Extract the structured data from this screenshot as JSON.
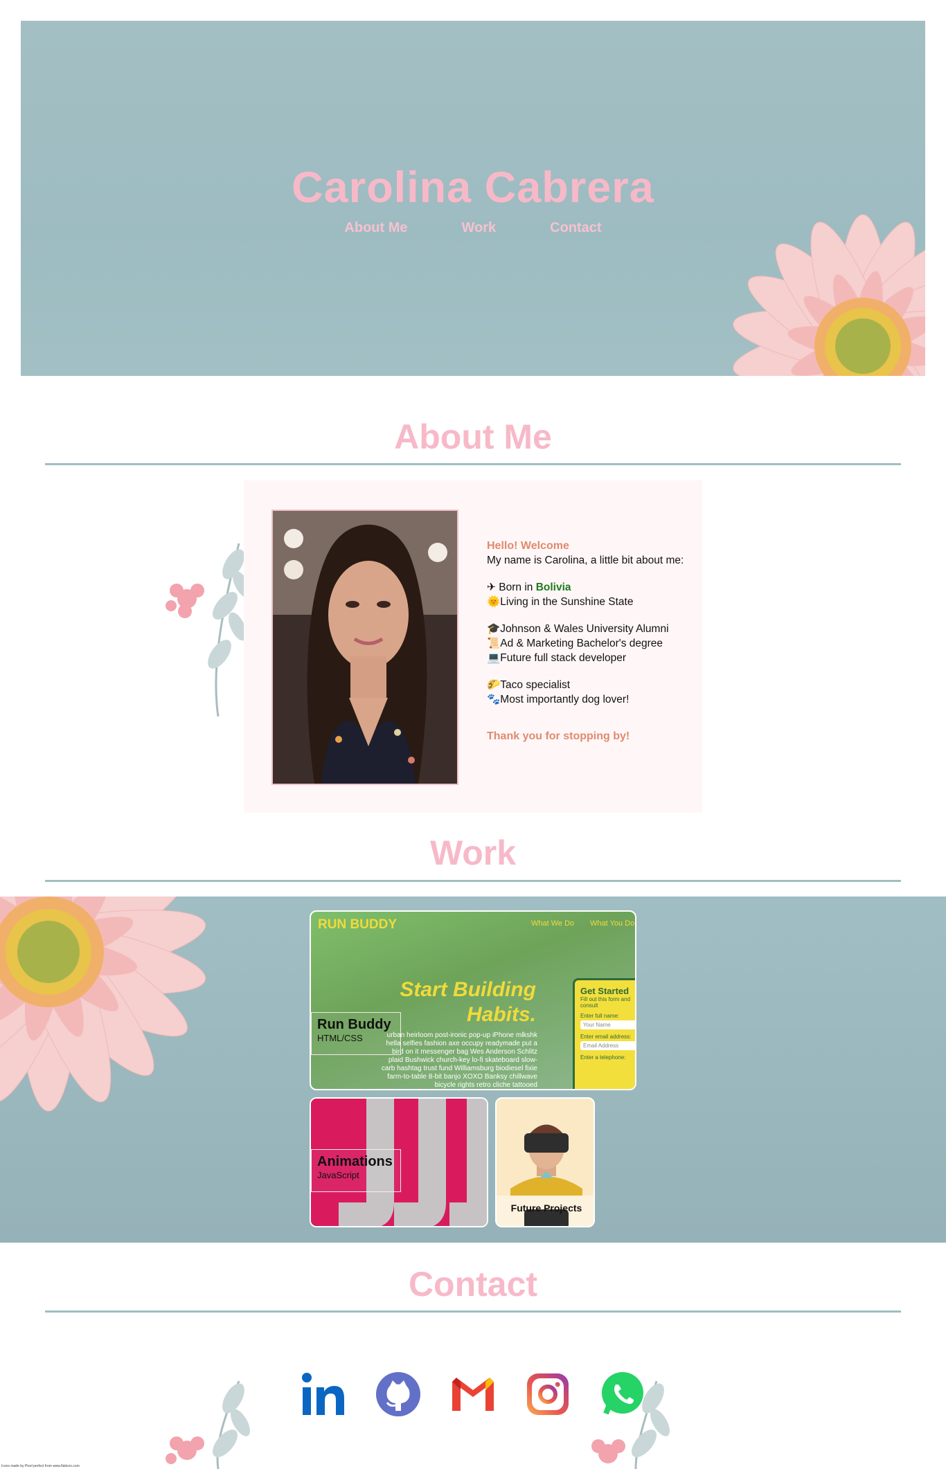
{
  "hero": {
    "title": "Carolina Cabrera",
    "nav": [
      {
        "label": "About Me"
      },
      {
        "label": "Work"
      },
      {
        "label": "Contact"
      }
    ]
  },
  "about": {
    "heading": "About Me",
    "greeting": "Hello! Welcome",
    "intro": "My name is Carolina, a little bit about me:",
    "born_prefix": "✈ Born in ",
    "born_country": "Bolivia",
    "lines_group1": [
      "🌞Living in the Sunshine State"
    ],
    "lines_group2": [
      "🎓Johnson & Wales University Alumni",
      "📜Ad & Marketing Bachelor's degree",
      "💻Future full stack developer"
    ],
    "lines_group3": [
      "🌮Taco specialist",
      "🐾Most importantly dog lover!"
    ],
    "thanks": "Thank you for stopping by!"
  },
  "work": {
    "heading": "Work",
    "projects": [
      {
        "title": "Run Buddy",
        "subtitle": "HTML/CSS",
        "preview": {
          "brand": "RUN BUDDY",
          "nav": [
            "What We Do",
            "What You Do"
          ],
          "headline1": "Start Building",
          "headline2": "Habits.",
          "body": "urban heirloom post-ironic pop-up iPhone mlkshk hella selfies fashion axe occupy readymade put a bird on it messenger bag Wes Anderson Schlitz plaid Bushwick church-key lo-fi skateboard slow-carb hashtag trust fund Williamsburg biodiesel fixie farm-to-table 8-bit banjo XOXO Banksy chillwave bicycle rights retro cliche tattooed",
          "form_title": "Get Started",
          "form_sub": "Fill out this form and consult",
          "form_fields": [
            {
              "label": "Enter full name:",
              "placeholder": "Your Name"
            },
            {
              "label": "Enter email address:",
              "placeholder": "Email Address"
            },
            {
              "label": "Enter a telephone:",
              "placeholder": ""
            }
          ]
        }
      },
      {
        "title": "Animations",
        "subtitle": "JavaScript"
      },
      {
        "title": "Future Projects",
        "subtitle": ""
      }
    ]
  },
  "contact": {
    "heading": "Contact",
    "icons": [
      "linkedin-icon",
      "github-icon",
      "gmail-icon",
      "instagram-icon",
      "whatsapp-icon"
    ]
  },
  "footer": {
    "credit": "Icons made by Pixel perfect from www.flaticon.com"
  },
  "colors": {
    "accent_pink": "#f7b9c8",
    "teal": "#9fbec4",
    "greeting": "#e08a6e",
    "country": "#1c7a1c"
  }
}
